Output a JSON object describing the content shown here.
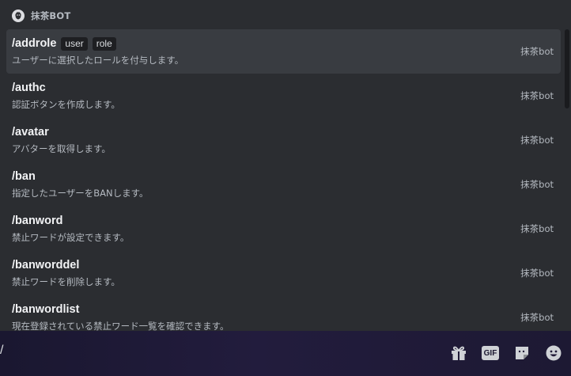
{
  "bot": {
    "name": "抹茶BOT"
  },
  "commands": [
    {
      "name": "/addrole",
      "options": [
        "user",
        "role"
      ],
      "description": "ユーザーに選択したロールを付与します。",
      "source": "抹茶bot",
      "selected": true
    },
    {
      "name": "/authc",
      "options": [],
      "description": "認証ボタンを作成します。",
      "source": "抹茶bot"
    },
    {
      "name": "/avatar",
      "options": [],
      "description": "アバターを取得します。",
      "source": "抹茶bot"
    },
    {
      "name": "/ban",
      "options": [],
      "description": "指定したユーザーをBANします。",
      "source": "抹茶bot"
    },
    {
      "name": "/banword",
      "options": [],
      "description": "禁止ワードが設定できます。",
      "source": "抹茶bot"
    },
    {
      "name": "/banworddel",
      "options": [],
      "description": "禁止ワードを削除します。",
      "source": "抹茶bot"
    },
    {
      "name": "/banwordlist",
      "options": [],
      "description": "現在登録されている禁止ワード一覧を確認できます。",
      "source": "抹茶bot"
    }
  ],
  "chat": {
    "input_value": "/",
    "gif_label": "GIF"
  },
  "colors": {
    "popup_bg": "#2b2d31",
    "selected_row": "#393c41",
    "chatbar_bg": "#1f1a36"
  },
  "icons": [
    "gift-icon",
    "gif-icon",
    "sticker-icon",
    "emoji-icon"
  ]
}
